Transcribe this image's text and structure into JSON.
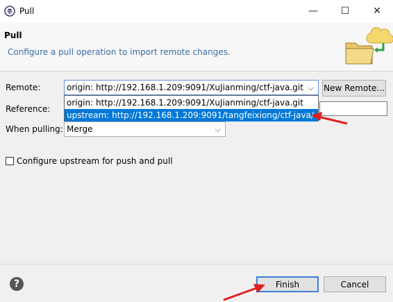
{
  "window": {
    "title": "Pull",
    "minimize_glyph": "—",
    "maximize_glyph": "☐",
    "close_glyph": "✕"
  },
  "header": {
    "title": "Pull",
    "description": "Configure a pull operation to import remote changes.",
    "icon": "folder-cloud-icon"
  },
  "form": {
    "remote_label": "Remote:",
    "remote_value": "origin: http://192.168.1.209:9091/XuJianming/ctf-java.git",
    "new_remote_label": "New Remote...",
    "reference_label": "Reference:",
    "when_pulling_label": "When pulling:",
    "when_pulling_value": "Merge",
    "configure_upstream_label": "Configure upstream for push and pull"
  },
  "dropdown": {
    "options": [
      "origin: http://192.168.1.209:9091/XuJianming/ctf-java.git",
      "upstream: http://192.168.1.209:9091/tangfeixiong/ctf-java/"
    ],
    "highlighted_index": 1
  },
  "footer": {
    "help_glyph": "?",
    "finish_label": "Finish",
    "cancel_label": "Cancel"
  },
  "colors": {
    "selection": "#0078d7",
    "annotation_arrow": "#e02020",
    "description_text": "#3a6ea5"
  }
}
